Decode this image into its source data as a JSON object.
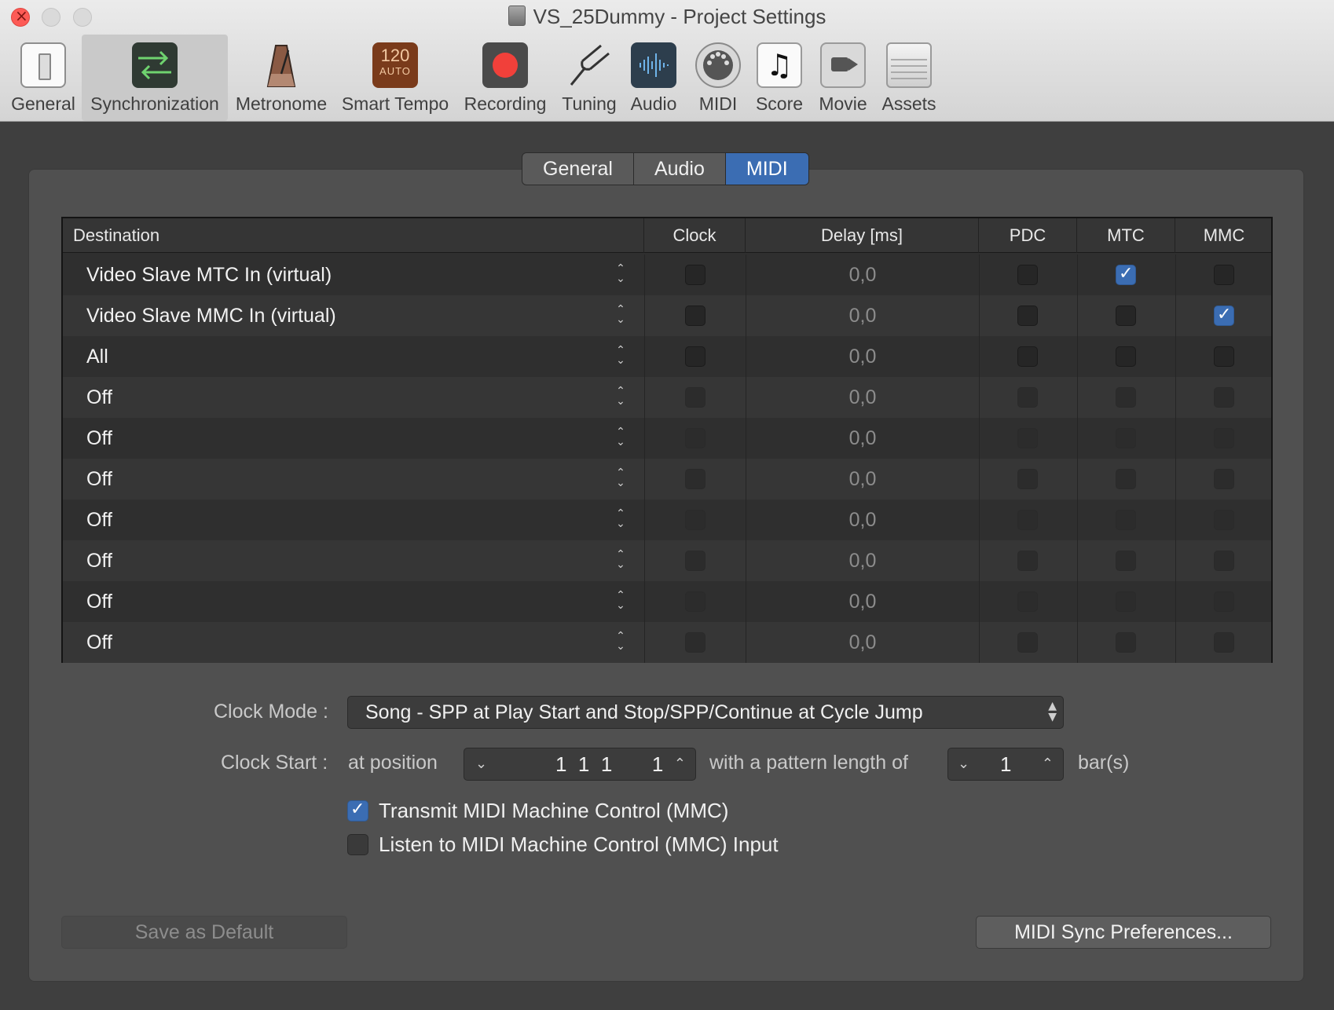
{
  "window": {
    "title": "VS_25Dummy - Project Settings"
  },
  "toolbar": {
    "items": [
      {
        "label": "General",
        "icon": "general-icon"
      },
      {
        "label": "Synchronization",
        "icon": "synchronization-icon",
        "selected": true
      },
      {
        "label": "Metronome",
        "icon": "metronome-icon"
      },
      {
        "label": "Smart Tempo",
        "icon": "smart-tempo-icon",
        "icon_text": "120",
        "icon_subtext": "AUTO"
      },
      {
        "label": "Recording",
        "icon": "record-icon"
      },
      {
        "label": "Tuning",
        "icon": "tuning-fork-icon"
      },
      {
        "label": "Audio",
        "icon": "waveform-icon"
      },
      {
        "label": "MIDI",
        "icon": "midi-port-icon"
      },
      {
        "label": "Score",
        "icon": "music-note-icon",
        "icon_text": "♫"
      },
      {
        "label": "Movie",
        "icon": "video-camera-icon"
      },
      {
        "label": "Assets",
        "icon": "briefcase-icon"
      }
    ]
  },
  "tabs": [
    {
      "label": "General"
    },
    {
      "label": "Audio"
    },
    {
      "label": "MIDI",
      "active": true
    }
  ],
  "table": {
    "headers": [
      "Destination",
      "Clock",
      "Delay [ms]",
      "PDC",
      "MTC",
      "MMC"
    ],
    "rows": [
      {
        "destination": "Video Slave MTC In (virtual)",
        "clock": false,
        "delay": "0,0",
        "pdc": false,
        "mtc": true,
        "mmc": false,
        "enabled": true
      },
      {
        "destination": "Video Slave MMC In (virtual)",
        "clock": false,
        "delay": "0,0",
        "pdc": false,
        "mtc": false,
        "mmc": true,
        "enabled": true
      },
      {
        "destination": "All",
        "clock": false,
        "delay": "0,0",
        "pdc": false,
        "mtc": false,
        "mmc": false,
        "enabled": true
      },
      {
        "destination": "Off",
        "clock": false,
        "delay": "0,0",
        "pdc": false,
        "mtc": false,
        "mmc": false,
        "enabled": false
      },
      {
        "destination": "Off",
        "clock": false,
        "delay": "0,0",
        "pdc": false,
        "mtc": false,
        "mmc": false,
        "enabled": false
      },
      {
        "destination": "Off",
        "clock": false,
        "delay": "0,0",
        "pdc": false,
        "mtc": false,
        "mmc": false,
        "enabled": false
      },
      {
        "destination": "Off",
        "clock": false,
        "delay": "0,0",
        "pdc": false,
        "mtc": false,
        "mmc": false,
        "enabled": false
      },
      {
        "destination": "Off",
        "clock": false,
        "delay": "0,0",
        "pdc": false,
        "mtc": false,
        "mmc": false,
        "enabled": false
      },
      {
        "destination": "Off",
        "clock": false,
        "delay": "0,0",
        "pdc": false,
        "mtc": false,
        "mmc": false,
        "enabled": false
      },
      {
        "destination": "Off",
        "clock": false,
        "delay": "0,0",
        "pdc": false,
        "mtc": false,
        "mmc": false,
        "enabled": false
      }
    ]
  },
  "clock_mode": {
    "label": "Clock Mode :",
    "value": "Song - SPP at Play Start and Stop/SPP/Continue at Cycle Jump"
  },
  "clock_start": {
    "label": "Clock Start :",
    "at_position_label": "at position",
    "position_value": "1  1  1       1",
    "pattern_label": "with a pattern length of",
    "pattern_value": "1",
    "unit": "bar(s)"
  },
  "options": [
    {
      "label": "Transmit MIDI Machine Control (MMC)",
      "checked": true
    },
    {
      "label": "Listen to MIDI Machine Control (MMC) Input",
      "checked": false
    }
  ],
  "buttons": {
    "save_default": "Save as Default",
    "midi_sync_prefs": "MIDI Sync Preferences..."
  },
  "colors": {
    "accent": "#3b6db3",
    "record": "#f1403a",
    "close": "#fd5b56"
  }
}
